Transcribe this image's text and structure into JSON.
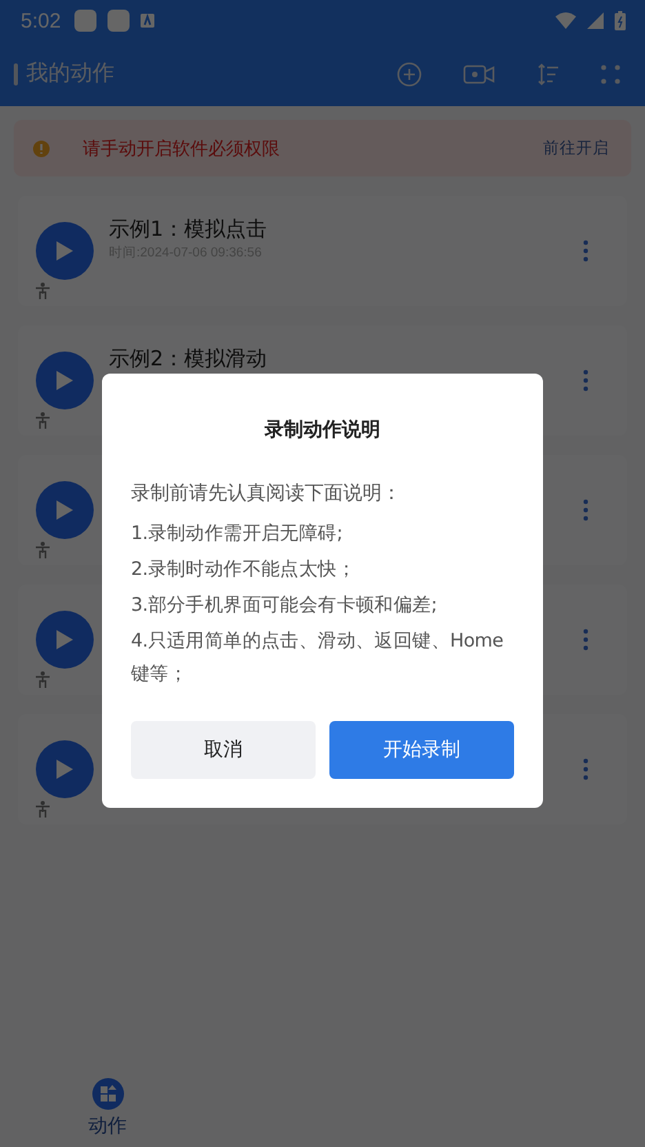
{
  "status_bar": {
    "time": "5:02"
  },
  "header": {
    "title": "我的动作"
  },
  "banner": {
    "message": "请手动开启软件必须权限",
    "action": "前往开启"
  },
  "actions": [
    {
      "kind": "titled",
      "title": "示例1：模拟点击",
      "time": "时间:2024-07-06 09:36:56"
    },
    {
      "kind": "titled",
      "title": "示例2：模拟滑动"
    },
    {
      "kind": "covered"
    },
    {
      "kind": "covered"
    },
    {
      "kind": "covered"
    }
  ],
  "bottom_nav": [
    {
      "label": "动作",
      "selected": true
    }
  ],
  "dialog": {
    "title": "录制动作说明",
    "intro": "录制前请先认真阅读下面说明：",
    "steps": [
      "1.录制动作需开启无障碍;",
      "2.录制时动作不能点太快；",
      "3.部分手机界面可能会有卡顿和偏差;",
      "4.只适用简单的点击、滑动、返回键、Home键等；"
    ],
    "buttons": [
      {
        "label": "取消",
        "kind": "secondary"
      },
      {
        "label": "开始录制",
        "kind": "primary"
      }
    ]
  }
}
